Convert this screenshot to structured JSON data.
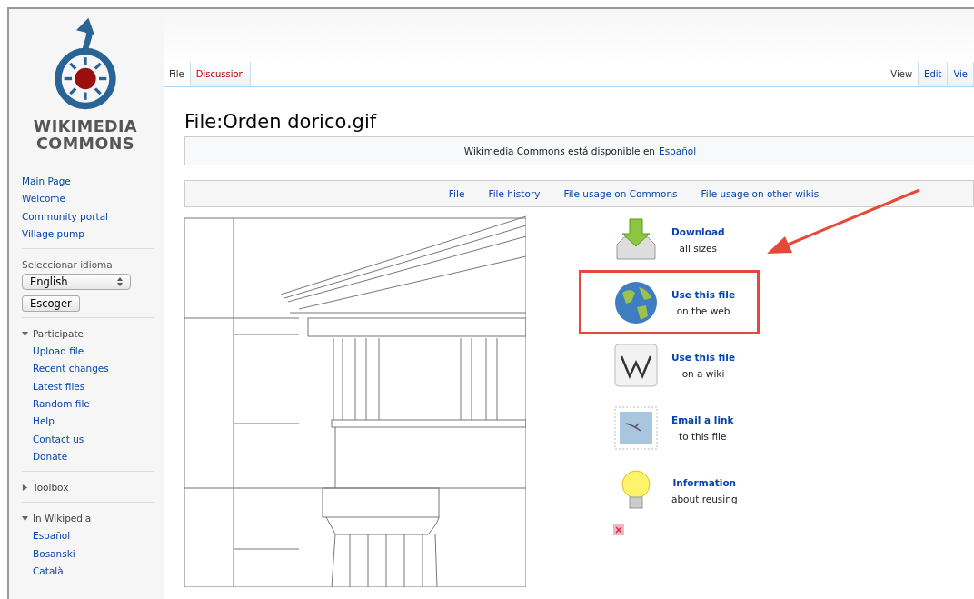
{
  "logo": {
    "line_1": "WIKIMEDIA",
    "line_2": "COMMONS"
  },
  "sidebar": {
    "nav": [
      "Main Page",
      "Welcome",
      "Community portal",
      "Village pump"
    ],
    "language": {
      "label": "Seleccionar idioma",
      "value": "English",
      "button": "Escoger"
    },
    "portlets": [
      {
        "title": "Participate",
        "expanded": true,
        "items": [
          "Upload file",
          "Recent changes",
          "Latest files",
          "Random file",
          "Help",
          "Contact us",
          "Donate"
        ]
      },
      {
        "title": "Toolbox",
        "expanded": false
      },
      {
        "title": "In Wikipedia",
        "expanded": true,
        "items": [
          "Español",
          "Bosanski",
          "Català"
        ]
      }
    ]
  },
  "tabs_left": [
    {
      "label": "File",
      "selected": true,
      "missing": false
    },
    {
      "label": "Discussion",
      "selected": false,
      "missing": true
    }
  ],
  "tabs_right": [
    {
      "label": "View",
      "selected": true
    },
    {
      "label": "Edit",
      "selected": false
    },
    {
      "label": "Vie",
      "selected": false
    }
  ],
  "title": "File:Orden dorico.gif",
  "notice": {
    "text": "Wikimedia Commons está disponible en",
    "link": "Español"
  },
  "file_nav": [
    "File",
    "File history",
    "File usage on Commons",
    "File usage on other wikis"
  ],
  "actions": [
    {
      "kind": "download",
      "title": "Download",
      "subtitle": "all sizes",
      "highlighted": false
    },
    {
      "kind": "globe",
      "title": "Use this file",
      "subtitle": "on the web",
      "highlighted": true
    },
    {
      "kind": "wiki",
      "title": "Use this file",
      "subtitle": "on a wiki",
      "highlighted": false
    },
    {
      "kind": "email",
      "title": "Email a link",
      "subtitle": "to this file",
      "highlighted": false
    },
    {
      "kind": "info",
      "title": "Information",
      "subtitle": "about reusing",
      "highlighted": false
    }
  ]
}
